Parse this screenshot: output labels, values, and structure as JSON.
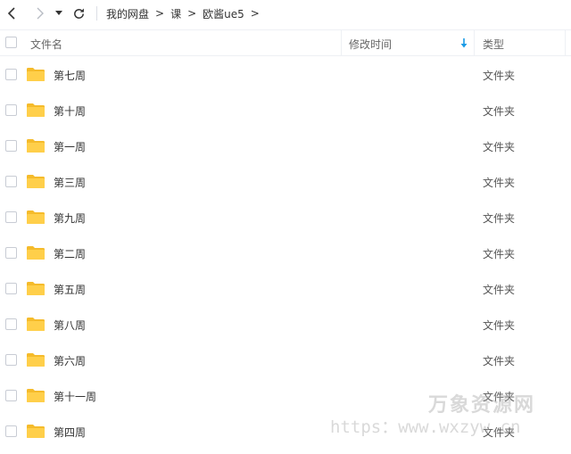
{
  "toolbar": {
    "back_icon": "chevron-left-icon",
    "forward_icon": "chevron-right-icon",
    "history_dropdown_icon": "caret-down-icon",
    "refresh_icon": "refresh-icon"
  },
  "breadcrumb": {
    "items": [
      "我的网盘",
      "课",
      "欧酱ue5"
    ],
    "separator": ">"
  },
  "table": {
    "columns": {
      "name": "文件名",
      "modified": "修改时间",
      "type": "类型"
    },
    "sort_icon": "arrow-down-icon",
    "sort_color": "#1a9be6",
    "folder_color": "#ffcf4a",
    "rows": [
      {
        "name": "第七周",
        "type": "文件夹"
      },
      {
        "name": "第十周",
        "type": "文件夹"
      },
      {
        "name": "第一周",
        "type": "文件夹"
      },
      {
        "name": "第三周",
        "type": "文件夹"
      },
      {
        "name": "第九周",
        "type": "文件夹"
      },
      {
        "name": "第二周",
        "type": "文件夹"
      },
      {
        "name": "第五周",
        "type": "文件夹"
      },
      {
        "name": "第八周",
        "type": "文件夹"
      },
      {
        "name": "第六周",
        "type": "文件夹"
      },
      {
        "name": "第十一周",
        "type": "文件夹"
      },
      {
        "name": "第四周",
        "type": "文件夹"
      }
    ]
  },
  "watermark": {
    "line1": "万象资源网",
    "line2": "https：www.wxzyw.cn"
  }
}
